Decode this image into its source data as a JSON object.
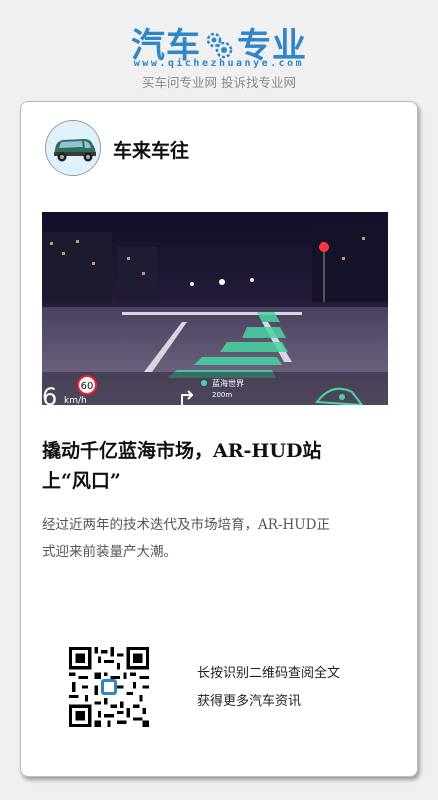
{
  "header": {
    "logo_left": "汽车",
    "logo_right": "专业",
    "logo_url": "www.qichezhuanye.com",
    "slogan": "买车问专业网 投诉找专业网",
    "brand_color": "#2f86c8"
  },
  "card": {
    "author_name": "车来车往",
    "hero_overlay": {
      "speed_limit": "60",
      "speed_unit": "km/h",
      "speed_digit": "6",
      "nav_street": "蓝海世界",
      "nav_distance": "200m"
    },
    "title": "撬动千亿蓝海市场，AR-HUD站上“风口”",
    "summary": "经过近两年的技术迭代及市场培育，AR-HUD正式迎来前装量产大潮。",
    "qr_hint_line1": "长按识别二维码查阅全文",
    "qr_hint_line2": "获得更多汽车资讯"
  }
}
